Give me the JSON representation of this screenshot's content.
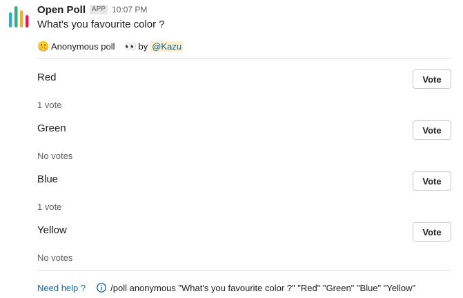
{
  "header": {
    "app_name": "Open Poll",
    "badge": "APP",
    "timestamp": "10:07 PM"
  },
  "logo": {
    "icon": "open-poll-logo",
    "bar_colors": [
      "#2bacd9",
      "#3aab7b",
      "#ecb22e",
      "#e01e5a"
    ]
  },
  "poll": {
    "question": "What's you favourite color ?",
    "anonymous_emoji": "🤫",
    "anonymous_label": "Anonymous poll",
    "eyes_emoji": "👀",
    "by_label": "by",
    "author_mention": "@Kazu",
    "options": [
      {
        "label": "Red",
        "votes": "1 vote",
        "button": "Vote"
      },
      {
        "label": "Green",
        "votes": "No votes",
        "button": "Vote"
      },
      {
        "label": "Blue",
        "votes": "1 vote",
        "button": "Vote"
      },
      {
        "label": "Yellow",
        "votes": "No votes",
        "button": "Vote"
      }
    ]
  },
  "footer": {
    "help_link": "Need help ?",
    "info_icon": "info-icon",
    "command": "/poll anonymous \"What's you favourite color ?\" \"Red\" \"Green\" \"Blue\" \"Yellow\""
  },
  "colors": {
    "link": "#1264a3",
    "mention_bg": "#fcefc7",
    "divider": "#dddddd"
  }
}
